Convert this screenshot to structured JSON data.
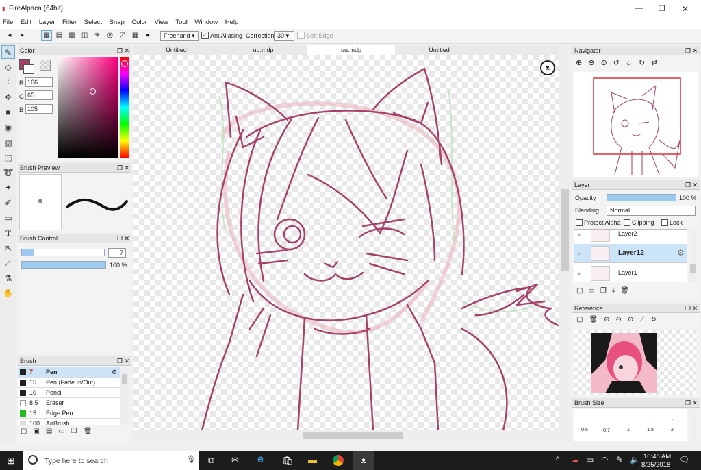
{
  "window": {
    "title": "FireAlpaca (64bit)",
    "min": "—",
    "max": "❐",
    "close": "✕"
  },
  "menu": [
    "File",
    "Edit",
    "Layer",
    "Filter",
    "Select",
    "Snap",
    "Color",
    "View",
    "Tool",
    "Window",
    "Help"
  ],
  "toolbar": {
    "mode": "Freehand",
    "antialias_label": "AntiAliasing",
    "correction_label": "Correction",
    "correction_value": "30",
    "soft_edge_label": "Soft Edge"
  },
  "tabs": [
    "Untitled",
    "uu.mdp",
    "uu.mdp",
    "Untitled"
  ],
  "color_panel": {
    "title": "Color",
    "r_label": "R",
    "r": "166",
    "g_label": "G",
    "g": "65",
    "b_label": "B",
    "b": "105",
    "current_color": "#a64169"
  },
  "brush_preview": {
    "title": "Brush Preview",
    "dot": "•"
  },
  "brush_control": {
    "title": "Brush Control",
    "size": "7",
    "opacity": "100 %"
  },
  "brush_panel": {
    "title": "Brush",
    "items": [
      {
        "size": "7",
        "name": "Pen",
        "swatch": "#222222"
      },
      {
        "size": "15",
        "name": "Pen (Fade In/Out)",
        "swatch": "#222222"
      },
      {
        "size": "10",
        "name": "Pencil",
        "swatch": "#222222"
      },
      {
        "size": "8.5",
        "name": "Eraser",
        "swatch": "#ffffff"
      },
      {
        "size": "15",
        "name": "Edge Pen",
        "swatch": "#22bb22"
      },
      {
        "size": "100",
        "name": "AirBrush",
        "swatch": "#dddddd"
      }
    ]
  },
  "navigator": {
    "title": "Navigator"
  },
  "layer_panel": {
    "title": "Layer",
    "opacity_label": "Opacity",
    "opacity_value": "100 %",
    "blending_label": "Blending",
    "blending_value": "Normal",
    "protect_alpha": "Protect Alpha",
    "clipping": "Clipping",
    "lock": "Lock",
    "layers": [
      "Layer2",
      "Layer12",
      "Layer1"
    ]
  },
  "reference": {
    "title": "Reference"
  },
  "brush_size": {
    "title": "Brush Size",
    "sizes": [
      "0.5",
      "0.7",
      "1",
      "1.5",
      "2"
    ]
  },
  "taskbar": {
    "search_placeholder": "Type here to search",
    "time": "10:48 AM",
    "date": "8/25/2018"
  },
  "colors": {
    "accent_blue": "#aad4f5",
    "selected_row": "#cce4f7",
    "stroke": "#a64169"
  }
}
